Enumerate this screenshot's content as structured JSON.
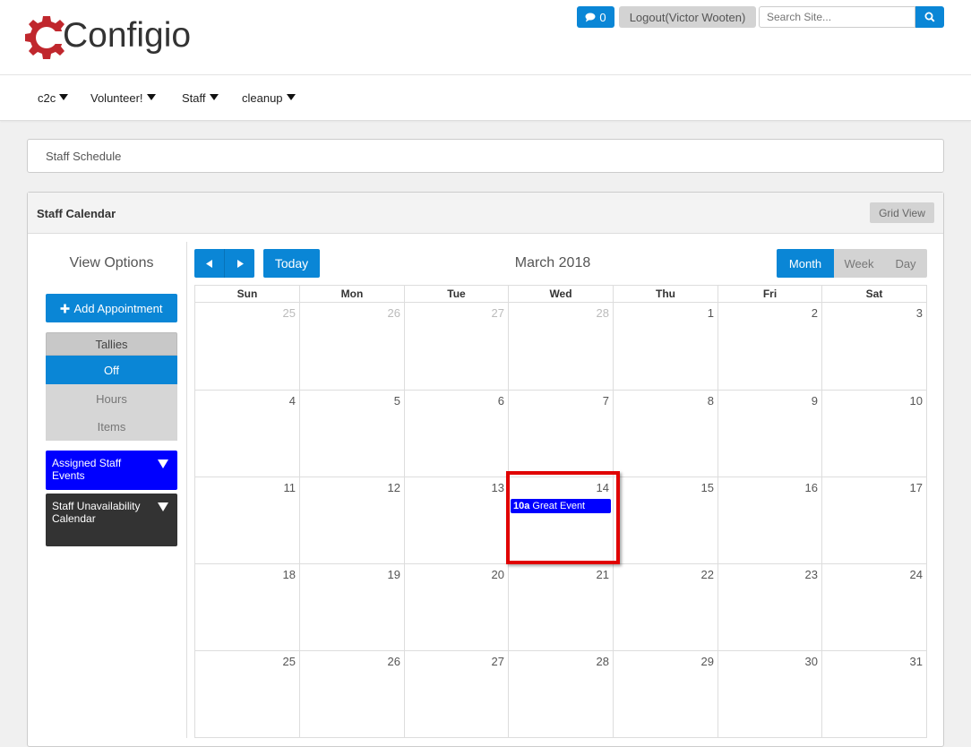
{
  "header": {
    "logo_text": "Configio",
    "messages_count": "0",
    "logout_label": "Logout(Victor Wooten)",
    "search_placeholder": "Search Site...",
    "brand_color": "#0a86d6",
    "logo_gear_color": "#c0272d"
  },
  "nav": {
    "items": [
      {
        "label": "c2c"
      },
      {
        "label": "Volunteer!"
      },
      {
        "label": "Staff"
      },
      {
        "label": "cleanup"
      }
    ]
  },
  "breadcrumb": "Staff Schedule",
  "panel": {
    "title": "Staff Calendar",
    "grid_view_label": "Grid View"
  },
  "sidebar": {
    "view_options": "View Options",
    "add_appointment": "Add Appointment",
    "tallies": {
      "header": "Tallies",
      "options": [
        "Off",
        "Hours",
        "Items"
      ],
      "selected": "Off"
    },
    "legends": [
      {
        "label": "Assigned Staff Events",
        "color": "#0000ff"
      },
      {
        "label": "Staff Unavailability Calendar",
        "color": "#333333"
      }
    ]
  },
  "calendar": {
    "today_label": "Today",
    "title": "March 2018",
    "views": [
      "Month",
      "Week",
      "Day"
    ],
    "active_view": "Month",
    "weekdays": [
      "Sun",
      "Mon",
      "Tue",
      "Wed",
      "Thu",
      "Fri",
      "Sat"
    ],
    "weeks": [
      [
        {
          "d": "25",
          "o": true
        },
        {
          "d": "26",
          "o": true
        },
        {
          "d": "27",
          "o": true
        },
        {
          "d": "28",
          "o": true
        },
        {
          "d": "1"
        },
        {
          "d": "2"
        },
        {
          "d": "3"
        }
      ],
      [
        {
          "d": "4"
        },
        {
          "d": "5"
        },
        {
          "d": "6"
        },
        {
          "d": "7"
        },
        {
          "d": "8"
        },
        {
          "d": "9"
        },
        {
          "d": "10"
        }
      ],
      [
        {
          "d": "11"
        },
        {
          "d": "12"
        },
        {
          "d": "13"
        },
        {
          "d": "14"
        },
        {
          "d": "15"
        },
        {
          "d": "16"
        },
        {
          "d": "17"
        }
      ],
      [
        {
          "d": "18"
        },
        {
          "d": "19"
        },
        {
          "d": "20"
        },
        {
          "d": "21"
        },
        {
          "d": "22"
        },
        {
          "d": "23"
        },
        {
          "d": "24"
        }
      ],
      [
        {
          "d": "25"
        },
        {
          "d": "26"
        },
        {
          "d": "27"
        },
        {
          "d": "28"
        },
        {
          "d": "29"
        },
        {
          "d": "30"
        },
        {
          "d": "31"
        }
      ]
    ],
    "event": {
      "time": "10a",
      "title": "Great Event",
      "day": "14",
      "color": "#0000ff"
    },
    "highlight_color": "#e00000"
  }
}
